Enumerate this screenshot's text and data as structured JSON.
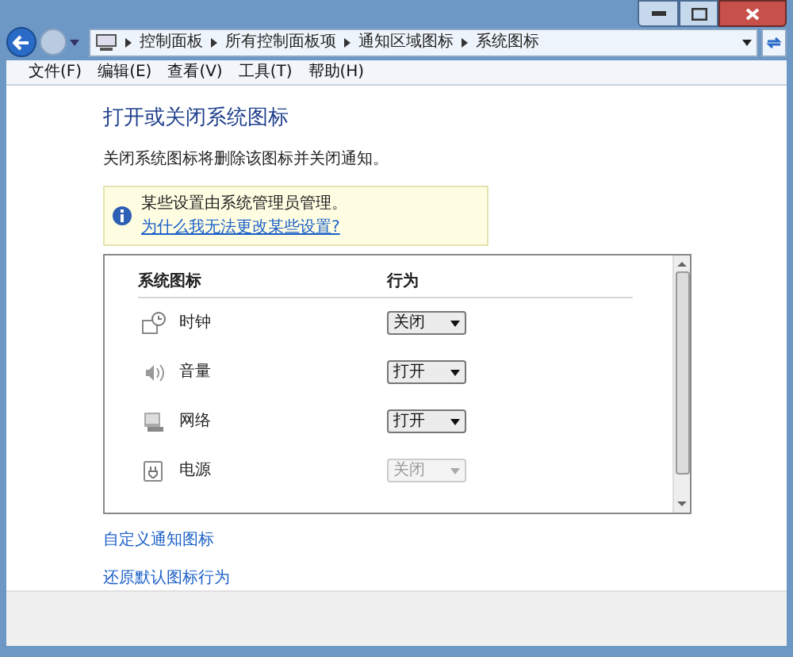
{
  "address_bar": {
    "breadcrumbs": [
      "控制面板",
      "所有控制面板项",
      "通知区域图标",
      "系统图标"
    ]
  },
  "menu_bar": [
    "文件(F)",
    "编辑(E)",
    "查看(V)",
    "工具(T)",
    "帮助(H)"
  ],
  "heading": "打开或关闭系统图标",
  "description": "关闭系统图标将删除该图标并关闭通知。",
  "notice": {
    "text": "某些设置由系统管理员管理。",
    "link": "为什么我无法更改某些设置?"
  },
  "table": {
    "columns": [
      "系统图标",
      "行为"
    ],
    "rows": [
      {
        "kind": "clock",
        "name": "时钟",
        "value": "关闭",
        "disabled": false
      },
      {
        "kind": "volume",
        "name": "音量",
        "value": "打开",
        "disabled": false
      },
      {
        "kind": "network",
        "name": "网络",
        "value": "打开",
        "disabled": false
      },
      {
        "kind": "power",
        "name": "电源",
        "value": "关闭",
        "disabled": true
      }
    ]
  },
  "links": [
    "自定义通知图标",
    "还原默认图标行为"
  ]
}
